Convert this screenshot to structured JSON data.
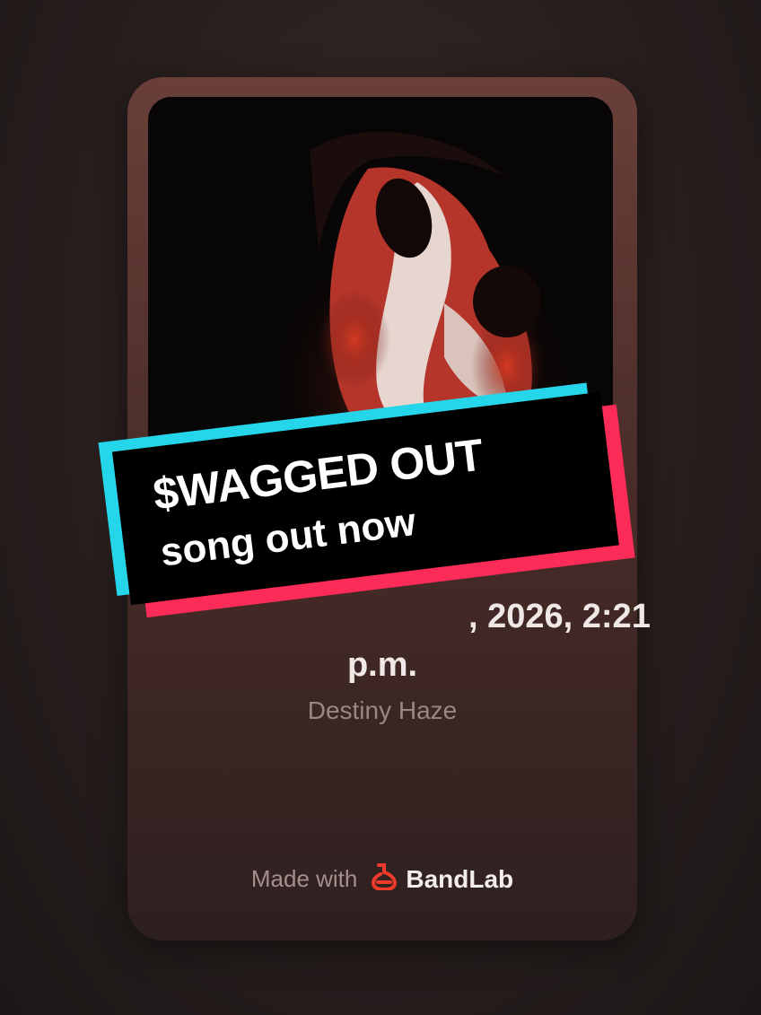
{
  "card": {
    "title_tail": ", 2026, 2:21",
    "title_pm": "p.m.",
    "artist": "Destiny Haze",
    "made_with": "Made with",
    "brand": "BandLab"
  },
  "banner": {
    "line1": "$WAGGED OUT",
    "line2": "song out now"
  },
  "colors": {
    "banner_cyan": "#25d6ea",
    "banner_red": "#fd2b57",
    "brand_red": "#f03a2a"
  },
  "icons": {
    "brand_logo": "bandlab-logo-icon"
  }
}
